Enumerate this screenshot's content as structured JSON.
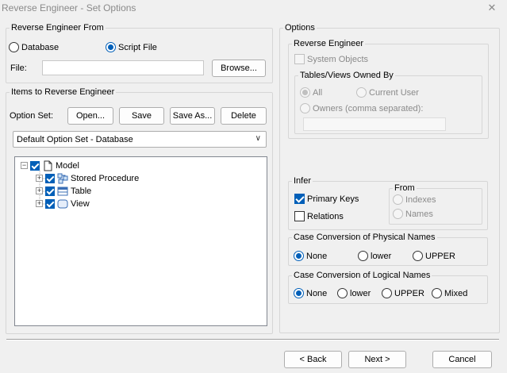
{
  "window": {
    "title": "Reverse Engineer - Set Options",
    "close_glyph": "✕"
  },
  "reverse_from": {
    "legend": "Reverse Engineer From",
    "database_label": "Database",
    "script_file_label": "Script File",
    "selected": "Script File",
    "file_label": "File:",
    "file_value": "",
    "browse_label": "Browse..."
  },
  "items": {
    "legend": "Items to Reverse Engineer",
    "option_set_label": "Option Set:",
    "open_label": "Open...",
    "save_label": "Save",
    "save_as_label": "Save As...",
    "delete_label": "Delete",
    "option_set_value": "Default Option Set - Database",
    "tree": [
      {
        "label": "Model",
        "checked": true,
        "icon": "document-icon",
        "expander": "−"
      },
      {
        "label": "Stored Procedure",
        "checked": true,
        "icon": "stored-procedure-icon",
        "expander": "+"
      },
      {
        "label": "Table",
        "checked": true,
        "icon": "table-icon",
        "expander": "+"
      },
      {
        "label": "View",
        "checked": true,
        "icon": "view-icon",
        "expander": "+"
      }
    ]
  },
  "options": {
    "legend": "Options",
    "reverse_engineer": {
      "legend": "Reverse Engineer",
      "system_objects_label": "System Objects",
      "system_objects_checked": false,
      "owned_by": {
        "legend": "Tables/Views Owned By",
        "all_label": "All",
        "current_user_label": "Current User",
        "owners_label": "Owners (comma separated):",
        "owners_value": "",
        "selected": "All"
      }
    },
    "infer": {
      "legend": "Infer",
      "primary_keys_label": "Primary Keys",
      "primary_keys_checked": true,
      "relations_label": "Relations",
      "relations_checked": false,
      "from": {
        "legend": "From",
        "indexes_label": "Indexes",
        "names_label": "Names"
      }
    },
    "case_physical": {
      "legend": "Case Conversion of Physical Names",
      "none_label": "None",
      "lower_label": "lower",
      "upper_label": "UPPER",
      "selected": "None"
    },
    "case_logical": {
      "legend": "Case Conversion of Logical Names",
      "none_label": "None",
      "lower_label": "lower",
      "upper_label": "UPPER",
      "mixed_label": "Mixed",
      "selected": "None"
    }
  },
  "footer": {
    "back_label": "< Back",
    "next_label": "Next >",
    "cancel_label": "Cancel"
  },
  "colors": {
    "accent": "#005fb8",
    "background": "#f0f0f0",
    "disabled_text": "#8a8a8a"
  }
}
